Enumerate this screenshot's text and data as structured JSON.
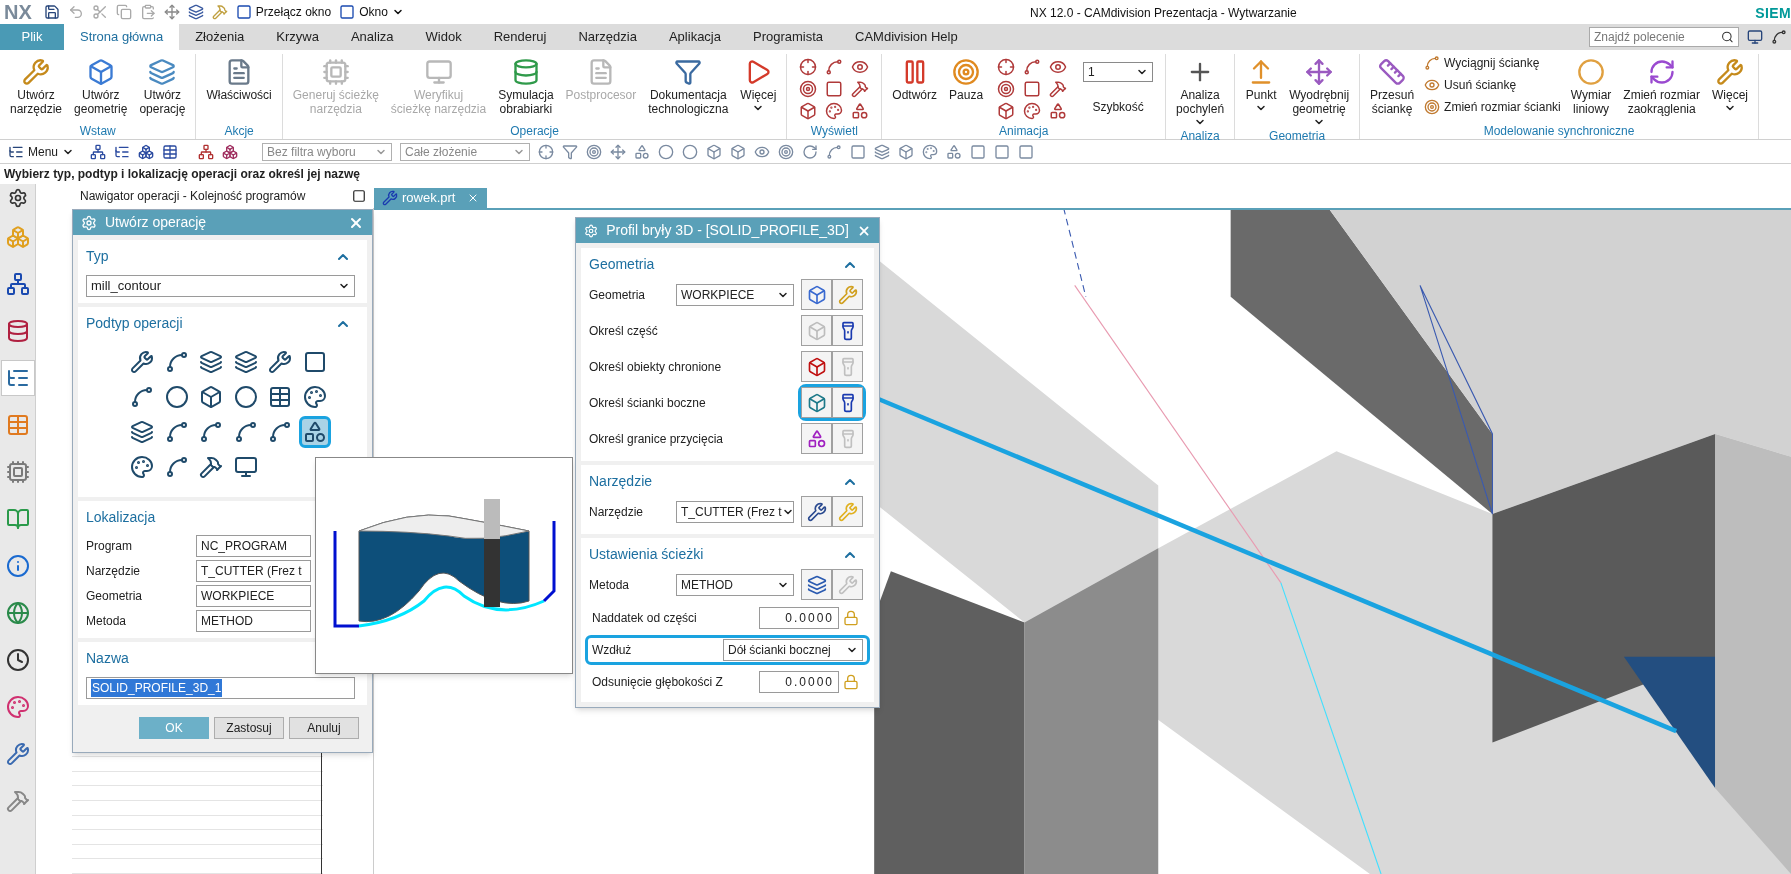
{
  "window": {
    "app": "NX",
    "title": "NX 12.0 - CAMdivision Prezentacja - Wytwarzanie",
    "brand": "SIEM"
  },
  "quick_access": [
    {
      "label": "Przełącz okno",
      "menu": false
    },
    {
      "label": "Okno",
      "menu": true
    }
  ],
  "tabs": [
    {
      "label": "Plik",
      "kind": "file",
      "selected": false
    },
    {
      "label": "Strona główna",
      "kind": "tab",
      "selected": true
    },
    {
      "label": "Złożenia",
      "kind": "tab",
      "selected": false
    },
    {
      "label": "Krzywa",
      "kind": "tab",
      "selected": false
    },
    {
      "label": "Analiza",
      "kind": "tab",
      "selected": false
    },
    {
      "label": "Widok",
      "kind": "tab",
      "selected": false
    },
    {
      "label": "Renderuj",
      "kind": "tab",
      "selected": false
    },
    {
      "label": "Narzędzia",
      "kind": "tab",
      "selected": false
    },
    {
      "label": "Aplikacja",
      "kind": "tab",
      "selected": false
    },
    {
      "label": "Programista",
      "kind": "tab",
      "selected": false
    },
    {
      "label": "CAMdivision Help",
      "kind": "tab",
      "selected": false
    }
  ],
  "search": {
    "placeholder": "Znajdź polecenie"
  },
  "ribbon_groups": [
    {
      "title": "Wstaw",
      "buttons": [
        {
          "kind": "large",
          "label": "Utwórz\nnarzędzie",
          "disabled": false,
          "menu": false
        },
        {
          "kind": "large",
          "label": "Utwórz\ngeometrię",
          "disabled": false,
          "menu": false
        },
        {
          "kind": "large",
          "label": "Utwórz\noperację",
          "disabled": false,
          "menu": false
        }
      ]
    },
    {
      "title": "Akcje",
      "buttons": [
        {
          "kind": "large",
          "label": "Właściwości",
          "disabled": false,
          "menu": false
        }
      ]
    },
    {
      "title": "Operacje",
      "buttons": [
        {
          "kind": "large",
          "label": "Generuj ścieżkę\nnarzędzia",
          "disabled": true,
          "menu": false
        },
        {
          "kind": "large",
          "label": "Weryfikuj\nścieżkę narzędzia",
          "disabled": true,
          "menu": false
        },
        {
          "kind": "large",
          "label": "Symulacja\nobrabiarki",
          "disabled": false,
          "menu": false
        },
        {
          "kind": "large",
          "label": "Postprocesor",
          "disabled": true,
          "menu": false
        },
        {
          "kind": "large",
          "label": "Dokumentacja\ntechnologiczna",
          "disabled": false,
          "menu": false
        },
        {
          "kind": "large",
          "label": "Więcej",
          "disabled": false,
          "menu": true
        }
      ]
    },
    {
      "title": "Wyświetl",
      "buttons": [
        {
          "kind": "icons"
        }
      ]
    },
    {
      "title": "Animacja",
      "buttons": [
        {
          "kind": "large",
          "label": "Odtwórz",
          "disabled": false,
          "menu": false
        },
        {
          "kind": "large",
          "label": "Pauza",
          "disabled": false,
          "menu": false
        },
        {
          "kind": "icons"
        },
        {
          "kind": "select",
          "value": "1",
          "label": "Szybkość"
        }
      ]
    },
    {
      "title": "Analiza",
      "buttons": [
        {
          "kind": "large",
          "label": "Analiza\npochyleń",
          "disabled": false,
          "menu": true
        }
      ]
    },
    {
      "title": "Geometria",
      "buttons": [
        {
          "kind": "large",
          "label": "Punkt",
          "disabled": false,
          "menu": true
        },
        {
          "kind": "large",
          "label": "Wyodrębnij\ngeometrię",
          "disabled": false,
          "menu": true
        }
      ]
    },
    {
      "title": "Modelowanie synchroniczne",
      "buttons": [
        {
          "kind": "large",
          "label": "Przesuń\nściankę",
          "disabled": false,
          "menu": false
        },
        {
          "kind": "small",
          "label": "Wyciągnij ściankę"
        },
        {
          "kind": "small",
          "label": "Usuń ściankę"
        },
        {
          "kind": "small",
          "label": "Zmień rozmiar ścianki"
        },
        {
          "kind": "large",
          "label": "Wymiar\nliniowy",
          "disabled": false,
          "menu": false
        },
        {
          "kind": "large",
          "label": "Zmień rozmiar\nzaokrąglenia",
          "disabled": false,
          "menu": false
        },
        {
          "kind": "large",
          "label": "Więcej",
          "disabled": false,
          "menu": true
        }
      ]
    }
  ],
  "toolbar": {
    "menu": "Menu",
    "filter": "Bez filtra wyboru",
    "scope": "Całe złożenie"
  },
  "prompt": "Wybierz typ, podtyp i lokalizację operacji oraz określ jej nazwę",
  "side_tools": [
    {
      "selected": false
    },
    {
      "selected": false
    },
    {
      "selected": false
    },
    {
      "selected": true
    },
    {
      "selected": false
    },
    {
      "selected": false
    },
    {
      "selected": false
    },
    {
      "selected": false
    },
    {
      "selected": false
    },
    {
      "selected": false
    },
    {
      "selected": false
    },
    {
      "selected": false
    },
    {
      "selected": false
    }
  ],
  "navigator": {
    "title": "Nawigator operacji - Kolejność programów"
  },
  "document_tab": {
    "label": "rowek.prt"
  },
  "create_dialog": {
    "title": "Utwórz operację",
    "type_section": {
      "title": "Typ",
      "value": "mill_contour"
    },
    "subtype_section": {
      "title": "Podtyp operacji",
      "items": [
        {
          "selected": false
        },
        {
          "selected": false
        },
        {
          "selected": false
        },
        {
          "selected": false
        },
        {
          "selected": false
        },
        {
          "selected": false
        },
        {
          "selected": false
        },
        {
          "selected": false
        },
        {
          "selected": false
        },
        {
          "selected": false
        },
        {
          "selected": false
        },
        {
          "selected": false
        },
        {
          "selected": false
        },
        {
          "selected": false
        },
        {
          "selected": false
        },
        {
          "selected": false
        },
        {
          "selected": false
        },
        {
          "selected": true
        },
        {
          "selected": false
        },
        {
          "selected": false
        },
        {
          "selected": false
        },
        {
          "selected": false
        }
      ]
    },
    "location_section": {
      "title": "Lokalizacja",
      "rows": [
        {
          "label": "Program",
          "value": "NC_PROGRAM"
        },
        {
          "label": "Narzędzie",
          "value": "T_CUTTER (Frez t"
        },
        {
          "label": "Geometria",
          "value": "WORKPIECE"
        },
        {
          "label": "Metoda",
          "value": "METHOD"
        }
      ]
    },
    "name_section": {
      "title": "Nazwa",
      "value": "SOLID_PROFILE_3D_1"
    },
    "buttons": [
      {
        "label": "OK",
        "primary": true
      },
      {
        "label": "Zastosuj",
        "primary": false
      },
      {
        "label": "Anuluj",
        "primary": false
      }
    ]
  },
  "profile_dialog": {
    "title": "Profil bryły 3D - [SOLID_PROFILE_3D]",
    "sections": [
      {
        "title": "Geometria",
        "rows": [
          {
            "kind": "select",
            "label": "Geometria",
            "value": "WORKPIECE",
            "highlighted": false
          },
          {
            "kind": "icons",
            "label": "Określ część",
            "highlighted": false
          },
          {
            "kind": "icons",
            "label": "Określ obiekty chronione",
            "highlighted": false
          },
          {
            "kind": "icons",
            "label": "Określ ścianki boczne",
            "highlighted": true
          },
          {
            "kind": "icons",
            "label": "Określ granice przycięcia",
            "highlighted": false
          }
        ]
      },
      {
        "title": "Narzędzie",
        "rows": [
          {
            "kind": "select",
            "label": "Narzędzie",
            "value": "T_CUTTER (Frez t",
            "highlighted": false
          }
        ]
      },
      {
        "title": "Ustawienia ścieżki",
        "rows": [
          {
            "kind": "select",
            "label": "Metoda",
            "value": "METHOD",
            "highlighted": false
          },
          {
            "kind": "number",
            "label": "Naddatek od części",
            "value": "0.0000",
            "highlighted": false
          },
          {
            "kind": "dropdown",
            "label": "Wzdłuż",
            "value": "Dół ścianki bocznej",
            "highlighted": true
          },
          {
            "kind": "number",
            "label": "Odsunięcie głębokości Z",
            "value": "0.0000",
            "highlighted": false
          }
        ]
      }
    ]
  }
}
